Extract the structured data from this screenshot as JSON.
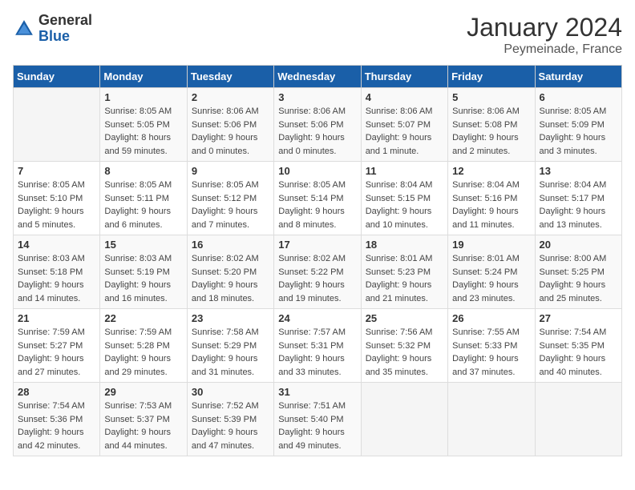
{
  "header": {
    "logo_text_general": "General",
    "logo_text_blue": "Blue",
    "month_title": "January 2024",
    "location": "Peymeinade, France"
  },
  "days_of_week": [
    "Sunday",
    "Monday",
    "Tuesday",
    "Wednesday",
    "Thursday",
    "Friday",
    "Saturday"
  ],
  "weeks": [
    [
      {
        "day": "",
        "empty": true
      },
      {
        "day": "1",
        "sunrise": "8:05 AM",
        "sunset": "5:05 PM",
        "daylight": "8 hours and 59 minutes."
      },
      {
        "day": "2",
        "sunrise": "8:06 AM",
        "sunset": "5:06 PM",
        "daylight": "9 hours and 0 minutes."
      },
      {
        "day": "3",
        "sunrise": "8:06 AM",
        "sunset": "5:06 PM",
        "daylight": "9 hours and 0 minutes."
      },
      {
        "day": "4",
        "sunrise": "8:06 AM",
        "sunset": "5:07 PM",
        "daylight": "9 hours and 1 minute."
      },
      {
        "day": "5",
        "sunrise": "8:06 AM",
        "sunset": "5:08 PM",
        "daylight": "9 hours and 2 minutes."
      },
      {
        "day": "6",
        "sunrise": "8:05 AM",
        "sunset": "5:09 PM",
        "daylight": "9 hours and 3 minutes."
      }
    ],
    [
      {
        "day": "7",
        "sunrise": "8:05 AM",
        "sunset": "5:10 PM",
        "daylight": "9 hours and 5 minutes."
      },
      {
        "day": "8",
        "sunrise": "8:05 AM",
        "sunset": "5:11 PM",
        "daylight": "9 hours and 6 minutes."
      },
      {
        "day": "9",
        "sunrise": "8:05 AM",
        "sunset": "5:12 PM",
        "daylight": "9 hours and 7 minutes."
      },
      {
        "day": "10",
        "sunrise": "8:05 AM",
        "sunset": "5:14 PM",
        "daylight": "9 hours and 8 minutes."
      },
      {
        "day": "11",
        "sunrise": "8:04 AM",
        "sunset": "5:15 PM",
        "daylight": "9 hours and 10 minutes."
      },
      {
        "day": "12",
        "sunrise": "8:04 AM",
        "sunset": "5:16 PM",
        "daylight": "9 hours and 11 minutes."
      },
      {
        "day": "13",
        "sunrise": "8:04 AM",
        "sunset": "5:17 PM",
        "daylight": "9 hours and 13 minutes."
      }
    ],
    [
      {
        "day": "14",
        "sunrise": "8:03 AM",
        "sunset": "5:18 PM",
        "daylight": "9 hours and 14 minutes."
      },
      {
        "day": "15",
        "sunrise": "8:03 AM",
        "sunset": "5:19 PM",
        "daylight": "9 hours and 16 minutes."
      },
      {
        "day": "16",
        "sunrise": "8:02 AM",
        "sunset": "5:20 PM",
        "daylight": "9 hours and 18 minutes."
      },
      {
        "day": "17",
        "sunrise": "8:02 AM",
        "sunset": "5:22 PM",
        "daylight": "9 hours and 19 minutes."
      },
      {
        "day": "18",
        "sunrise": "8:01 AM",
        "sunset": "5:23 PM",
        "daylight": "9 hours and 21 minutes."
      },
      {
        "day": "19",
        "sunrise": "8:01 AM",
        "sunset": "5:24 PM",
        "daylight": "9 hours and 23 minutes."
      },
      {
        "day": "20",
        "sunrise": "8:00 AM",
        "sunset": "5:25 PM",
        "daylight": "9 hours and 25 minutes."
      }
    ],
    [
      {
        "day": "21",
        "sunrise": "7:59 AM",
        "sunset": "5:27 PM",
        "daylight": "9 hours and 27 minutes."
      },
      {
        "day": "22",
        "sunrise": "7:59 AM",
        "sunset": "5:28 PM",
        "daylight": "9 hours and 29 minutes."
      },
      {
        "day": "23",
        "sunrise": "7:58 AM",
        "sunset": "5:29 PM",
        "daylight": "9 hours and 31 minutes."
      },
      {
        "day": "24",
        "sunrise": "7:57 AM",
        "sunset": "5:31 PM",
        "daylight": "9 hours and 33 minutes."
      },
      {
        "day": "25",
        "sunrise": "7:56 AM",
        "sunset": "5:32 PM",
        "daylight": "9 hours and 35 minutes."
      },
      {
        "day": "26",
        "sunrise": "7:55 AM",
        "sunset": "5:33 PM",
        "daylight": "9 hours and 37 minutes."
      },
      {
        "day": "27",
        "sunrise": "7:54 AM",
        "sunset": "5:35 PM",
        "daylight": "9 hours and 40 minutes."
      }
    ],
    [
      {
        "day": "28",
        "sunrise": "7:54 AM",
        "sunset": "5:36 PM",
        "daylight": "9 hours and 42 minutes."
      },
      {
        "day": "29",
        "sunrise": "7:53 AM",
        "sunset": "5:37 PM",
        "daylight": "9 hours and 44 minutes."
      },
      {
        "day": "30",
        "sunrise": "7:52 AM",
        "sunset": "5:39 PM",
        "daylight": "9 hours and 47 minutes."
      },
      {
        "day": "31",
        "sunrise": "7:51 AM",
        "sunset": "5:40 PM",
        "daylight": "9 hours and 49 minutes."
      },
      {
        "day": "",
        "empty": true
      },
      {
        "day": "",
        "empty": true
      },
      {
        "day": "",
        "empty": true
      }
    ]
  ],
  "labels": {
    "sunrise": "Sunrise:",
    "sunset": "Sunset:",
    "daylight": "Daylight:"
  }
}
